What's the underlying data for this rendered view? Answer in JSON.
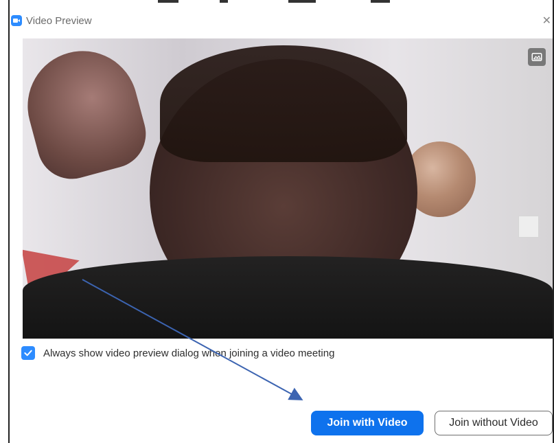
{
  "window": {
    "title": "Video Preview",
    "close_symbol": "✕"
  },
  "video": {
    "description_icon": "image-icon"
  },
  "options": {
    "always_show_label": "Always show video preview dialog when joining a video meeting",
    "always_show_checked": true
  },
  "buttons": {
    "join_with_video": "Join with Video",
    "join_without_video": "Join without Video"
  },
  "colors": {
    "accent": "#0e72ed",
    "checkbox": "#2d8cff",
    "annotation_arrow": "#3c64b1"
  },
  "icons": {
    "app": "zoom-app-icon",
    "close": "close-icon",
    "check": "check-icon",
    "image": "image-icon",
    "annotation": "arrow-annotation"
  }
}
